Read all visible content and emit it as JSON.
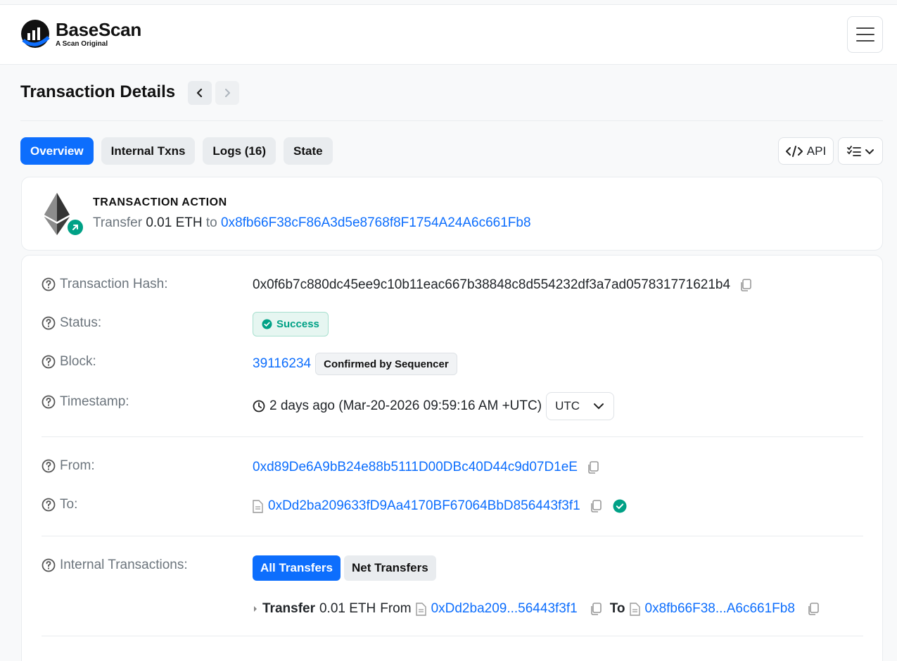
{
  "header": {
    "brand_name": "BaseScan",
    "brand_tagline": "A Scan Original"
  },
  "page": {
    "title": "Transaction Details"
  },
  "tabs": [
    {
      "label": "Overview",
      "active": true
    },
    {
      "label": "Internal Txns",
      "active": false
    },
    {
      "label": "Logs (16)",
      "active": false
    },
    {
      "label": "State",
      "active": false
    }
  ],
  "toolbar": {
    "api_label": "API"
  },
  "action": {
    "heading": "TRANSACTION ACTION",
    "verb": "Transfer",
    "amount": "0.01 ETH",
    "to_word": "to",
    "to_address": "0x8fb66F38cF86A3d5e8768f8F1754A24A6c661Fb8"
  },
  "details": {
    "tx_hash": {
      "label": "Transaction Hash:",
      "value": "0x0f6b7c880dc45ee9c10b11eac667b38848c8d554232df3a7ad057831771621b4"
    },
    "status": {
      "label": "Status:",
      "value": "Success"
    },
    "block": {
      "label": "Block:",
      "value": "39116234",
      "badge": "Confirmed by Sequencer"
    },
    "timestamp": {
      "label": "Timestamp:",
      "value": "2 days ago (Mar-20-2026 09:59:16 AM +UTC)",
      "timezone": "UTC"
    },
    "from": {
      "label": "From:",
      "value": "0xd89De6A9bB24e88b5111D00DBc40D44c9d07D1eE"
    },
    "to": {
      "label": "To:",
      "value": "0xDd2ba209633fD9Aa4170BF67064BbD856443f3f1"
    },
    "internal": {
      "label": "Internal Transactions:",
      "filters": [
        {
          "label": "All Transfers",
          "active": true
        },
        {
          "label": "Net Transfers",
          "active": false
        }
      ],
      "transfer": {
        "verb": "Transfer",
        "amount": "0.01 ETH",
        "from_word": "From",
        "from_address": "0xDd2ba209...56443f3f1",
        "to_word": "To",
        "to_address": "0x8fb66F38...A6c661Fb8"
      }
    }
  },
  "colors": {
    "primary": "#0d6efd",
    "success": "#00a186",
    "muted": "#6c757d"
  }
}
